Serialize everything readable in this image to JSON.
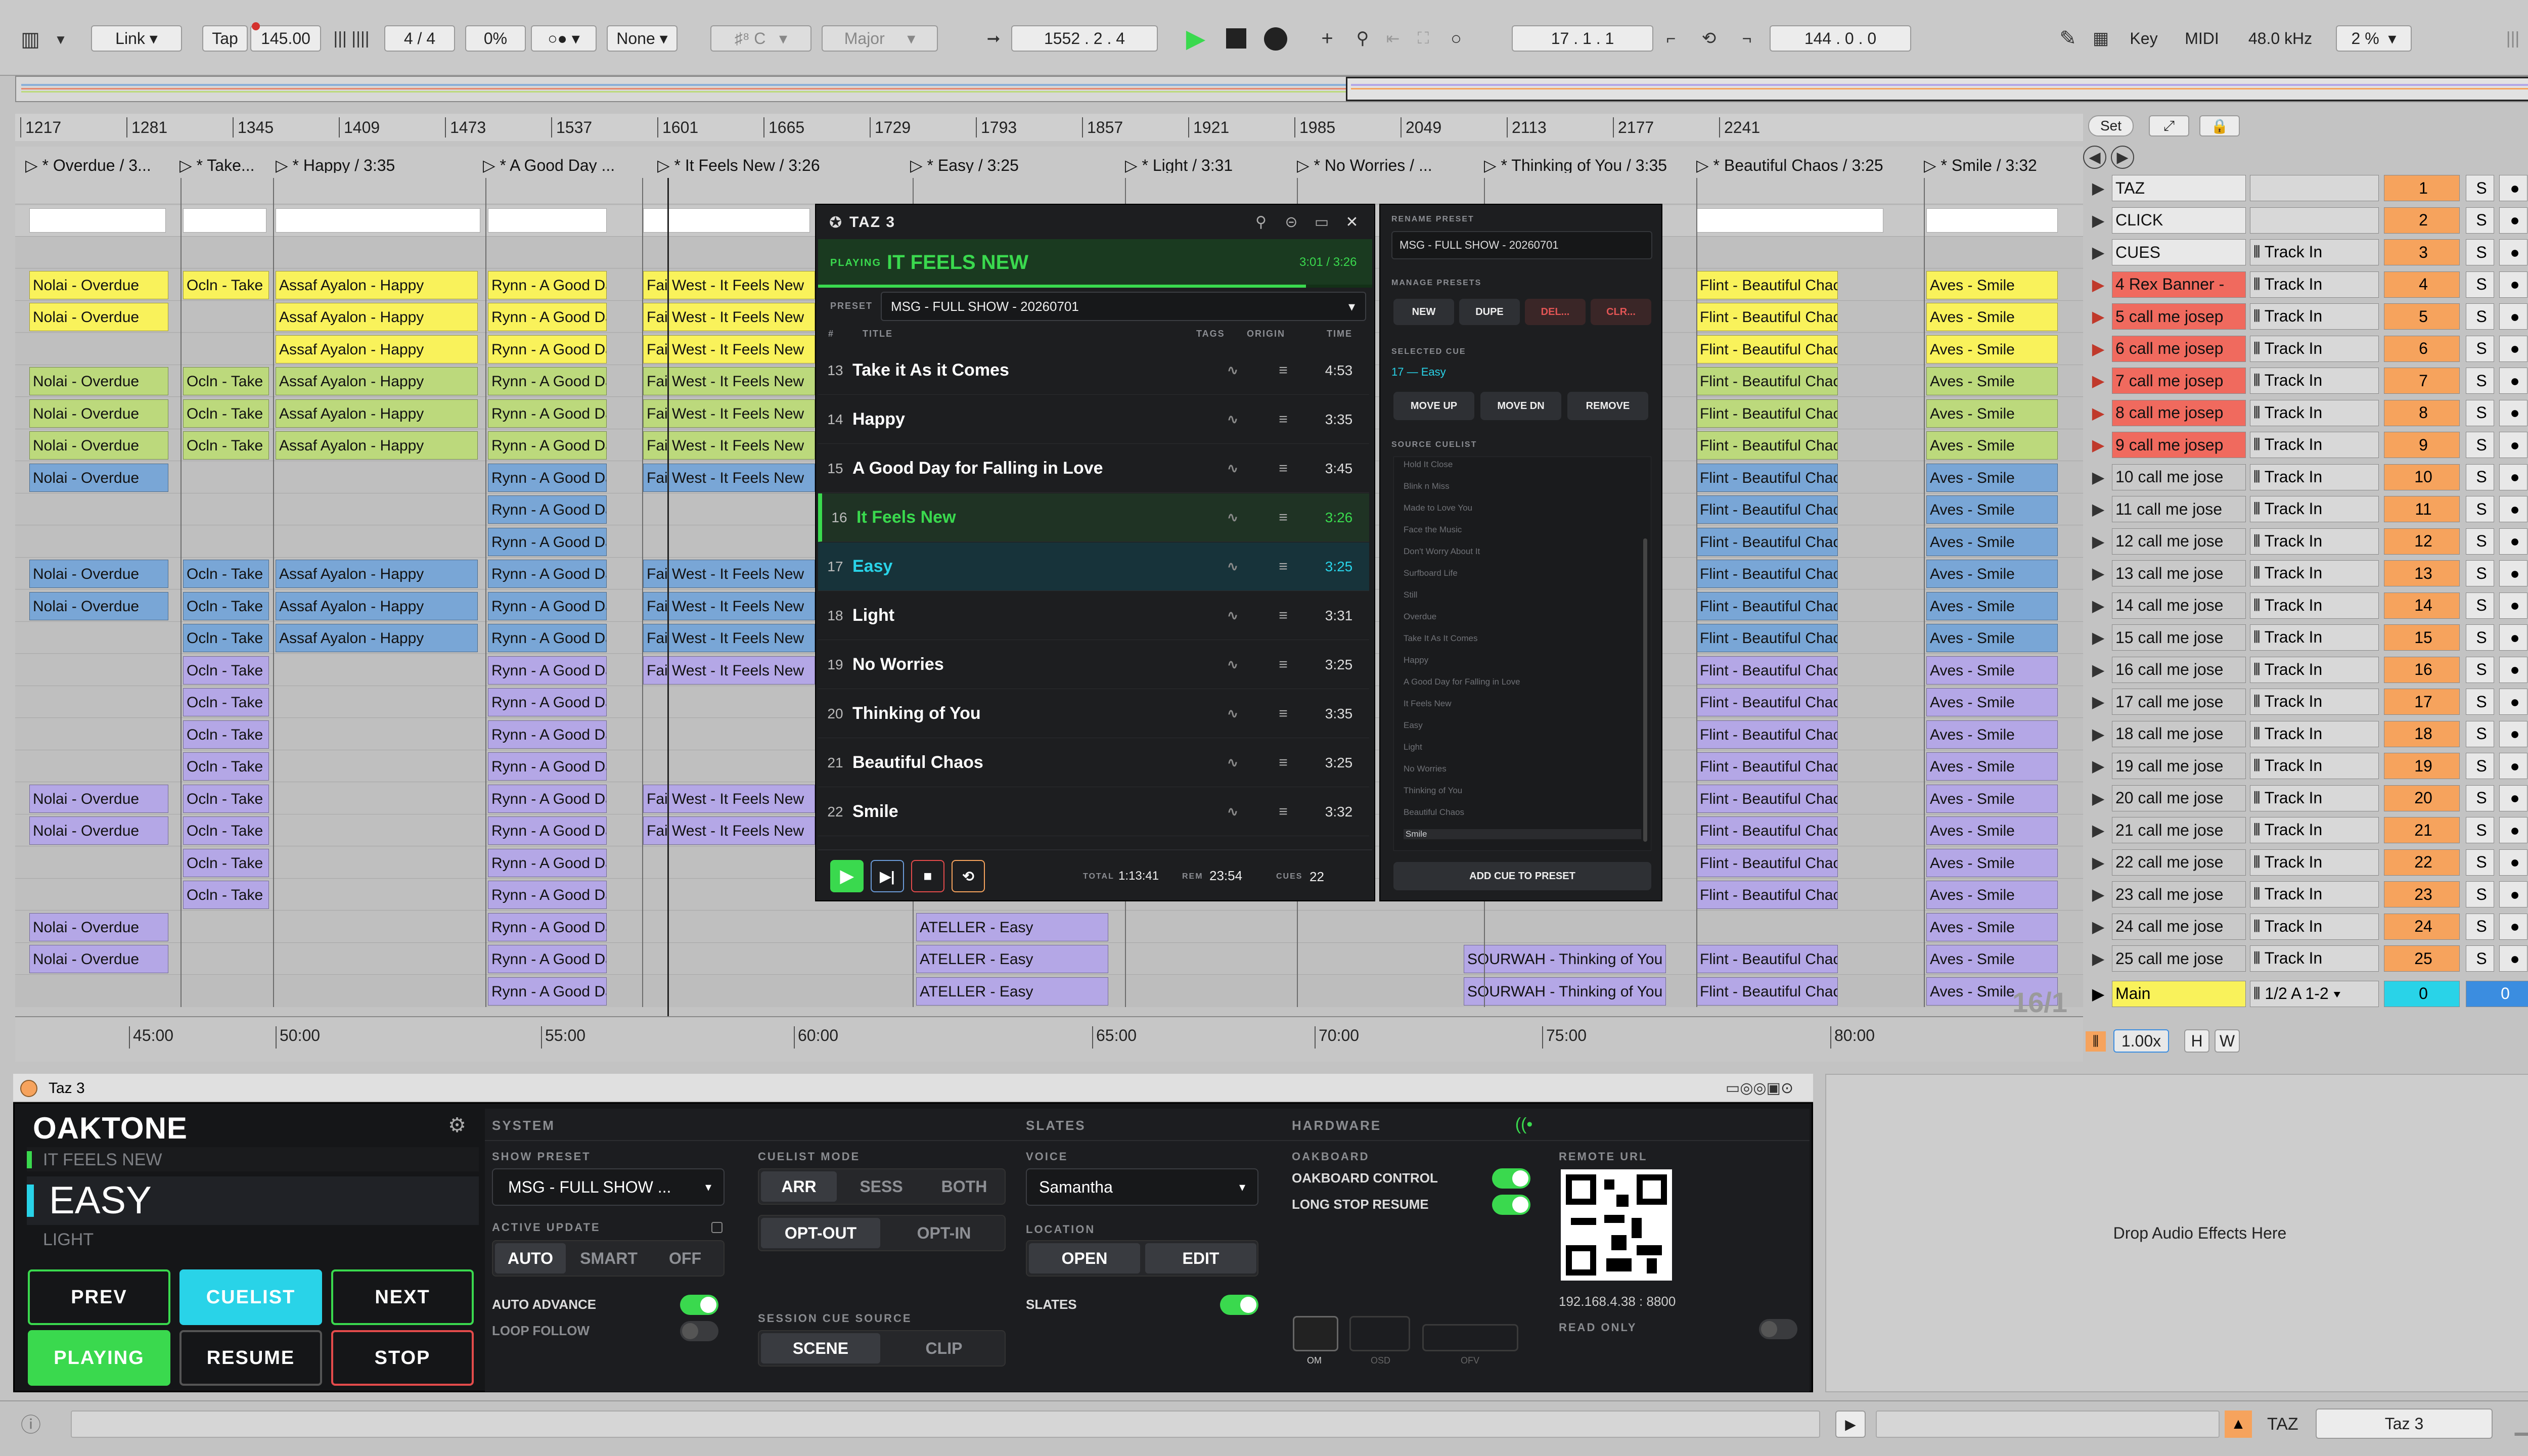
{
  "colors": {
    "red": "#f06a5e",
    "orange": "#f6a35d",
    "yellow": "#f9f25b",
    "lime": "#bcd97c",
    "green": "#a5d47c",
    "blue": "#79a6d6",
    "purple": "#b4a7e6",
    "salmon": "#e6886e",
    "accent": "#3ad94e",
    "cyan": "#29d3e8"
  },
  "toolbar": {
    "link": "Link",
    "tap": "Tap",
    "bpm": "145.00",
    "sig": "4 / 4",
    "groove": "0%",
    "quant": "None",
    "key_root": "C",
    "scale": "Major",
    "position": "1552 .  2 .  4",
    "loop_start": "17 .  1 .  1",
    "loop_len": "144 .  0 .  0",
    "key": "Key",
    "midi": "MIDI",
    "rate": "48.0 kHz",
    "cpu": "2 %"
  },
  "ruler": [
    "1217",
    "1281",
    "1345",
    "1409",
    "1473",
    "1537",
    "1601",
    "1665",
    "1729",
    "1793",
    "1857",
    "1921",
    "1985",
    "2049",
    "2113",
    "2177",
    "2241"
  ],
  "set_btn": "Set",
  "locators": [
    "* Overdue / 3...",
    "* Take...",
    "* Happy / 3:35",
    "* A Good Day ...",
    "* It Feels New / 3:26",
    "* Easy / 3:25",
    "* Light / 3:31",
    "* No Worries / ...",
    "* Thinking of You / 3:35",
    "* Beautiful Chaos / 3:25",
    "* Smile / 3:32"
  ],
  "clip_names": {
    "nolai": "Nolai - Overdue",
    "ocln": "Ocln - Take It As It Comes",
    "assaf": "Assaf Ayalon - Happy",
    "rynn": "Rynn - A Good Day",
    "west": "Fai West - It Feels New",
    "atelier": "ATELLER - Easy",
    "sourwah": "SOURWAH - Thinking of You",
    "flint": "Flint - Beautiful Chaos",
    "aves": "Aves - Smile"
  },
  "tracks": [
    {
      "name": "TAZ",
      "num": "1",
      "input": "",
      "type": "audio"
    },
    {
      "name": "CLICK",
      "num": "2",
      "input": "",
      "type": "audio"
    },
    {
      "name": "CUES",
      "num": "3",
      "input": "Track In",
      "type": "audio"
    },
    {
      "name": "4 Rex Banner -",
      "num": "4",
      "input": "Track In",
      "type": "rec"
    },
    {
      "name": "5 call me josep",
      "num": "5",
      "input": "Track In",
      "type": "rec"
    },
    {
      "name": "6 call me josep",
      "num": "6",
      "input": "Track In",
      "type": "rec"
    },
    {
      "name": "7 call me josep",
      "num": "7",
      "input": "Track In",
      "type": "rec"
    },
    {
      "name": "8 call me josep",
      "num": "8",
      "input": "Track In",
      "type": "rec"
    },
    {
      "name": "9 call me josep",
      "num": "9",
      "input": "Track In",
      "type": "rec"
    },
    {
      "name": "10 call me jose",
      "num": "10",
      "input": "Track In",
      "type": "play"
    },
    {
      "name": "11 call me jose",
      "num": "11",
      "input": "Track In",
      "type": "play"
    },
    {
      "name": "12 call me jose",
      "num": "12",
      "input": "Track In",
      "type": "play"
    },
    {
      "name": "13 call me jose",
      "num": "13",
      "input": "Track In",
      "type": "play"
    },
    {
      "name": "14 call me jose",
      "num": "14",
      "input": "Track In",
      "type": "play"
    },
    {
      "name": "15 call me jose",
      "num": "15",
      "input": "Track In",
      "type": "play"
    },
    {
      "name": "16 call me jose",
      "num": "16",
      "input": "Track In",
      "type": "play"
    },
    {
      "name": "17 call me jose",
      "num": "17",
      "input": "Track In",
      "type": "play"
    },
    {
      "name": "18 call me jose",
      "num": "18",
      "input": "Track In",
      "type": "play"
    },
    {
      "name": "19 call me jose",
      "num": "19",
      "input": "Track In",
      "type": "play"
    },
    {
      "name": "20 call me jose",
      "num": "20",
      "input": "Track In",
      "type": "play"
    },
    {
      "name": "21 call me jose",
      "num": "21",
      "input": "Track In",
      "type": "play"
    },
    {
      "name": "22 call me jose",
      "num": "22",
      "input": "Track In",
      "type": "play"
    },
    {
      "name": "23 call me jose",
      "num": "23",
      "input": "Track In",
      "type": "play"
    },
    {
      "name": "24 call me jose",
      "num": "24",
      "input": "Track In",
      "type": "play"
    },
    {
      "name": "25 call me jose",
      "num": "25",
      "input": "Track In",
      "type": "play"
    }
  ],
  "main_track": {
    "name": "Main",
    "input": "1/2 A 1-2",
    "vol": "0",
    "pan": "0"
  },
  "solo": "S",
  "timecodes": [
    "45:00",
    "50:00",
    "55:00",
    "60:00",
    "65:00",
    "70:00",
    "75:00",
    "80:00"
  ],
  "scroll_label": "16/1",
  "zoom": "1.00x",
  "h": "H",
  "w": "W",
  "taz": {
    "title": "TAZ 3",
    "playing_tag": "PLAYING",
    "now_playing": "IT FEELS NEW",
    "progress": "3:01 / 3:26",
    "preset_label": "PRESET",
    "preset": "MSG - FULL SHOW - 20260701",
    "cols": {
      "num": "#",
      "title": "TITLE",
      "tags": "TAGS",
      "origin": "ORIGIN",
      "time": "TIME"
    },
    "rows": [
      {
        "n": "13",
        "t": "Take it As it Comes",
        "d": "4:53"
      },
      {
        "n": "14",
        "t": "Happy",
        "d": "3:35"
      },
      {
        "n": "15",
        "t": "A Good Day for Falling in Love",
        "d": "3:45"
      },
      {
        "n": "16",
        "t": "It Feels New",
        "d": "3:26"
      },
      {
        "n": "17",
        "t": "Easy",
        "d": "3:25"
      },
      {
        "n": "18",
        "t": "Light",
        "d": "3:31"
      },
      {
        "n": "19",
        "t": "No Worries",
        "d": "3:25"
      },
      {
        "n": "20",
        "t": "Thinking of You",
        "d": "3:35"
      },
      {
        "n": "21",
        "t": "Beautiful Chaos",
        "d": "3:25"
      },
      {
        "n": "22",
        "t": "Smile",
        "d": "3:32"
      }
    ],
    "total_label": "TOTAL",
    "total": "1:13:41",
    "rem_label": "REM",
    "rem": "23:54",
    "cues_label": "CUES",
    "cues": "22"
  },
  "right_panel": {
    "rename_label": "RENAME PRESET",
    "rename_value": "MSG - FULL SHOW - 20260701",
    "manage_label": "MANAGE PRESETS",
    "new": "NEW",
    "dupe": "DUPE",
    "del": "DEL...",
    "clr": "CLR...",
    "selected_label": "SELECTED CUE",
    "selected": "17 — Easy",
    "move_up": "MOVE UP",
    "move_dn": "MOVE DN",
    "remove": "REMOVE",
    "source_label": "SOURCE CUELIST",
    "source": [
      "Hold It Close",
      "Blink n Miss",
      "Made to Love You",
      "Face the Music",
      "Don't Worry About It",
      "Surfboard Life",
      "Still",
      "Overdue",
      "Take It As It Comes",
      "Happy",
      "A Good Day for Falling in Love",
      "It Feels New",
      "Easy",
      "Light",
      "No Worries",
      "Thinking of You",
      "Beautiful Chaos",
      "Smile"
    ],
    "add": "ADD CUE TO PRESET"
  },
  "device": {
    "title": "Taz 3",
    "logo": "OAKTONE",
    "prev_cue": "IT FEELS NEW",
    "cur_cue": "EASY",
    "next_cue": "LIGHT",
    "prev": "PREV",
    "cuelist": "CUELIST",
    "next": "NEXT",
    "playing": "PLAYING",
    "resume": "RESUME",
    "stop": "STOP",
    "system": "SYSTEM",
    "show_preset_label": "SHOW PRESET",
    "show_preset": "MSG - FULL SHOW ...",
    "active_update": "ACTIVE UPDATE",
    "auto": "AUTO",
    "smart": "SMART",
    "off": "OFF",
    "auto_advance": "AUTO ADVANCE",
    "loop_follow": "LOOP FOLLOW",
    "cuelist_mode": "CUELIST MODE",
    "arr": "ARR",
    "sess": "SESS",
    "both": "BOTH",
    "opt_out": "OPT-OUT",
    "opt_in": "OPT-IN",
    "session_src": "SESSION CUE SOURCE",
    "scene": "SCENE",
    "clip": "CLIP",
    "slates": "SLATES",
    "voice_label": "VOICE",
    "voice": "Samantha",
    "location": "LOCATION",
    "open": "OPEN",
    "edit": "EDIT",
    "slates_toggle": "SLATES",
    "hardware": "HARDWARE",
    "oakboard": "OAKBOARD",
    "oak_ctrl": "OAKBOARD CONTROL",
    "long_stop": "LONG STOP RESUME",
    "om": "OM",
    "osd": "OSD",
    "ofv": "OFV",
    "remote": "REMOTE URL",
    "ip": "192.168.4.38 : 8800",
    "readonly": "READ ONLY"
  },
  "drop_text": "Drop Audio Effects Here",
  "status": {
    "taz": "TAZ",
    "track": "Taz 3"
  }
}
